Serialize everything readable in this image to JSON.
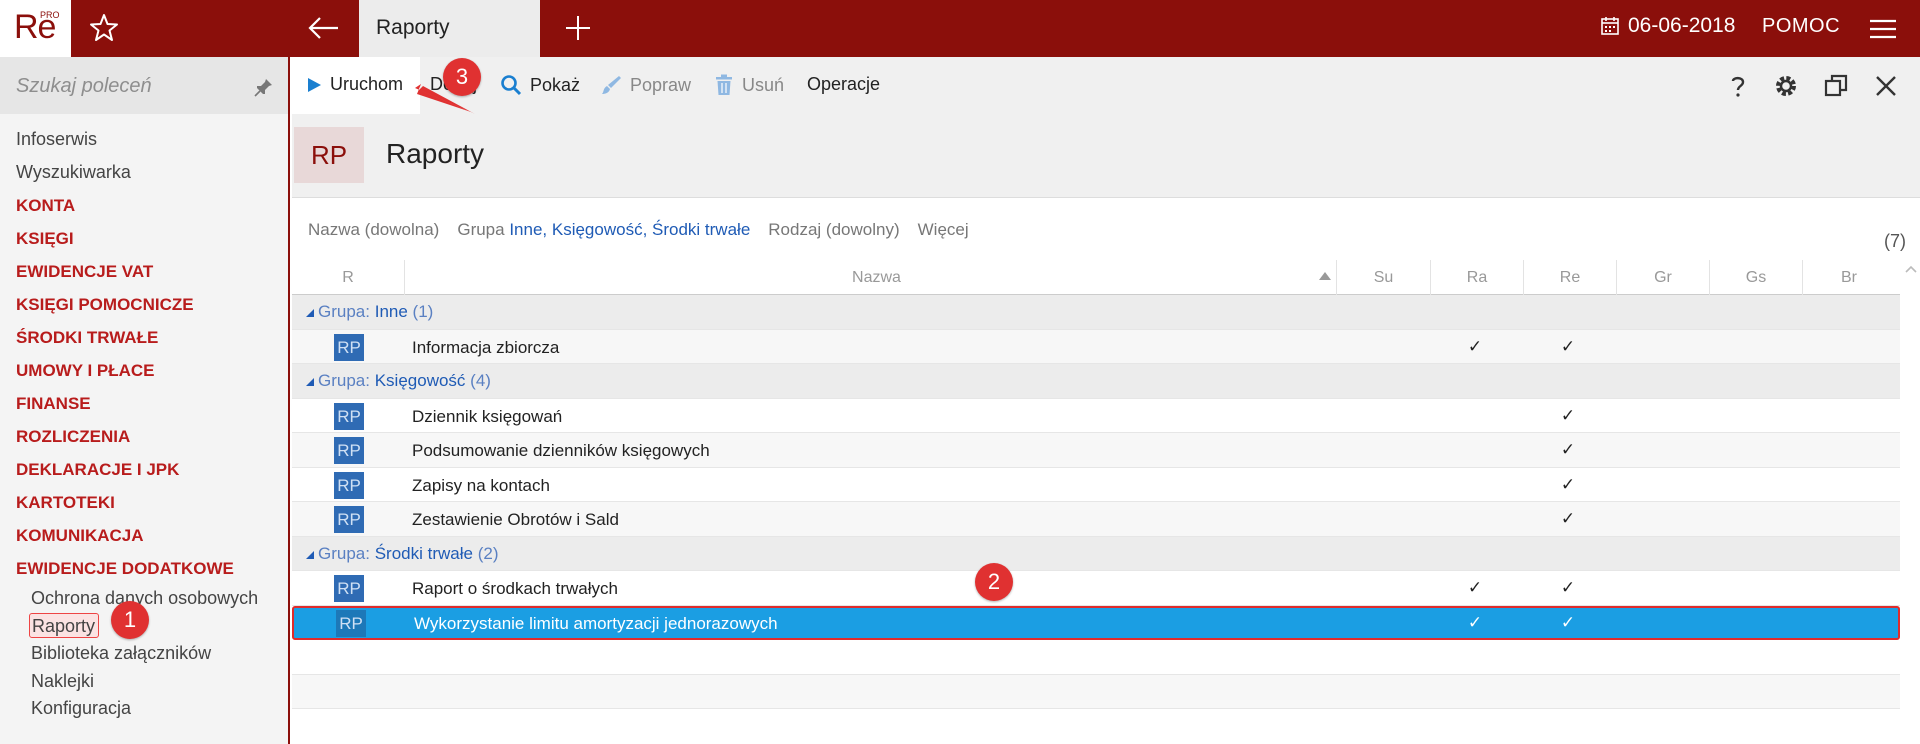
{
  "app": {
    "logo": "Re",
    "logo_badge": "PRO",
    "active_tab": "Raporty",
    "date": "06-06-2018",
    "help": "POMOC"
  },
  "sidebar": {
    "search_placeholder": "Szukaj poleceń",
    "items": [
      {
        "label": "Infoserwis",
        "type": "link"
      },
      {
        "label": "Wyszukiwarka",
        "type": "link"
      },
      {
        "label": "KONTA",
        "type": "section"
      },
      {
        "label": "KSIĘGI",
        "type": "section"
      },
      {
        "label": "EWIDENCJE VAT",
        "type": "section"
      },
      {
        "label": "KSIĘGI POMOCNICZE",
        "type": "section"
      },
      {
        "label": "ŚRODKI TRWAŁE",
        "type": "section"
      },
      {
        "label": "UMOWY I PŁACE",
        "type": "section"
      },
      {
        "label": "FINANSE",
        "type": "section"
      },
      {
        "label": "ROZLICZENIA",
        "type": "section"
      },
      {
        "label": "DEKLARACJE I JPK",
        "type": "section"
      },
      {
        "label": "KARTOTEKI",
        "type": "section"
      },
      {
        "label": "KOMUNIKACJA",
        "type": "section"
      },
      {
        "label": "EWIDENCJE DODATKOWE",
        "type": "section"
      }
    ],
    "subitems": [
      "Ochrona danych osobowych",
      "Raporty",
      "Biblioteka załączników",
      "Naklejki",
      "Konfiguracja"
    ]
  },
  "toolbar": {
    "run": "Uruchom",
    "add": "Dodaj",
    "show": "Pokaż",
    "edit": "Popraw",
    "delete": "Usuń",
    "operations": "Operacje"
  },
  "header": {
    "badge": "RP",
    "title": "Raporty"
  },
  "filters": {
    "name": "Nazwa (dowolna)",
    "group_label": "Grupa",
    "group_value": "Inne, Księgowość, Środki trwałe",
    "kind": "Rodzaj (dowolny)",
    "more": "Więcej",
    "count": "(7)"
  },
  "grid": {
    "columns": [
      "R",
      "Nazwa",
      "Su",
      "Ra",
      "Re",
      "Gr",
      "Gs",
      "Br"
    ],
    "group_prefix": "Grupa:",
    "groups": [
      {
        "name": "Inne",
        "count": "(1)"
      },
      {
        "name": "Księgowość",
        "count": "(4)"
      },
      {
        "name": "Środki trwałe",
        "count": "(2)"
      }
    ],
    "rows": [
      {
        "icon": "RP",
        "name": "Informacja zbiorcza",
        "ra": "✓",
        "re": "✓"
      },
      {
        "icon": "RP",
        "name": "Dziennik księgowań",
        "ra": "",
        "re": "✓"
      },
      {
        "icon": "RP",
        "name": "Podsumowanie dzienników księgowych",
        "ra": "",
        "re": "✓"
      },
      {
        "icon": "RP",
        "name": "Zapisy na kontach",
        "ra": "",
        "re": "✓"
      },
      {
        "icon": "RP",
        "name": "Zestawienie Obrotów i Sald",
        "ra": "",
        "re": "✓"
      },
      {
        "icon": "RP",
        "name": "Raport o środkach trwałych",
        "ra": "✓",
        "re": "✓"
      },
      {
        "icon": "RP",
        "name": "Wykorzystanie limitu amortyzacji jednorazowych",
        "ra": "✓",
        "re": "✓"
      }
    ]
  },
  "callouts": [
    "1",
    "2",
    "3"
  ],
  "colors": {
    "brand": "#8b0f0b",
    "selection": "#1b9ee3",
    "callout": "#e03131",
    "link": "#1f5bb5"
  }
}
